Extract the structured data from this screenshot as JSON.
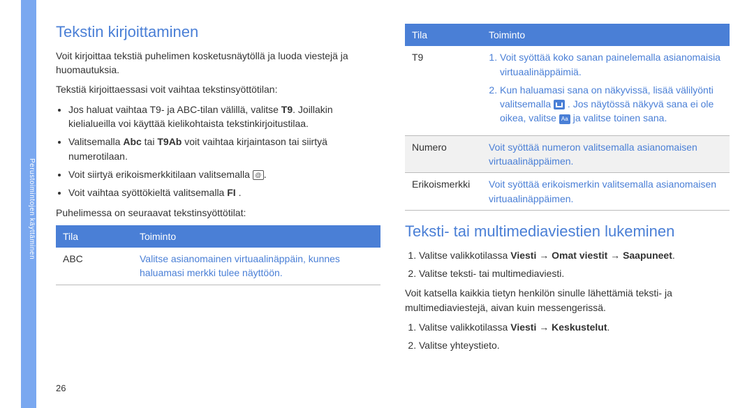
{
  "sidebar_label": "Perustoimintojen käyttäminen",
  "page_number": "26",
  "left": {
    "h1": "Tekstin kirjoittaminen",
    "p1": "Voit kirjoittaa tekstiä puhelimen kosketusnäytöllä ja luoda viestejä ja huomautuksia.",
    "p2": "Tekstiä kirjoittaessasi voit vaihtaa tekstinsyöttötilan:",
    "bullets": {
      "b1a": "Jos haluat vaihtaa T9- ja ABC-tilan välillä, valitse ",
      "b1b": "T9",
      "b1c": ". Joillakin kielialueilla voi käyttää kielikohtaista tekstinkirjoitustilaa.",
      "b2a": "Valitsemalla ",
      "b2b": "Abc",
      "b2c": " tai ",
      "b2d": "T9Ab",
      "b2e": " voit vaihtaa kirjaintason tai siirtyä numerotilaan.",
      "b3a": "Voit siirtyä erikoismerkkitilaan valitsemalla ",
      "b3b": ".",
      "b4a": "Voit vaihtaa syöttökieltä valitsemalla ",
      "b4b": "FI",
      "b4c": " ."
    },
    "p3": "Puhelimessa on seuraavat tekstinsyöttötilat:",
    "table_h1": "Tila",
    "table_h2": "Toiminto",
    "row1_mode": "ABC",
    "row1_func": "Valitse asianomainen virtuaalinäppäin, kunnes haluamasi merkki tulee näyttöön."
  },
  "right": {
    "table_h1": "Tila",
    "table_h2": "Toiminto",
    "row1_mode": "T9",
    "row1_f1": "Voit syöttää koko sanan painelemalla asianomaisia virtuaalinäppäimiä.",
    "row1_f2a": "Kun haluamasi sana on näkyvissä, lisää välilyönti valitsemalla ",
    "row1_f2b": " . Jos näytössä näkyvä sana ei ole oikea, valitse ",
    "row1_f2c": " ja valitse toinen sana.",
    "row2_mode": "Numero",
    "row2_func": "Voit syöttää numeron valitsemalla asianomaisen virtuaalinäppäimen.",
    "row3_mode": "Erikoismerkki",
    "row3_func": "Voit syöttää erikoismerkin valitsemalla asianomaisen virtuaalinäppäimen.",
    "h1": "Teksti- tai multimediaviestien lukeminen",
    "ol1_a": "Valitse valikkotilassa ",
    "ol1_b": "Viesti",
    "ol1_c": " → ",
    "ol1_d": "Omat viestit",
    "ol1_e": " → ",
    "ol1_f": "Saapuneet",
    "ol1_g": ".",
    "ol2": "Valitse teksti- tai multimediaviesti.",
    "p1": "Voit katsella kaikkia tietyn henkilön sinulle lähettämiä teksti- ja multimediaviestejä, aivan kuin messengerissä.",
    "ol3_a": "Valitse valikkotilassa ",
    "ol3_b": "Viesti",
    "ol3_c": " → ",
    "ol3_d": "Keskustelut",
    "ol3_e": ".",
    "ol4": "Valitse yhteystieto."
  }
}
